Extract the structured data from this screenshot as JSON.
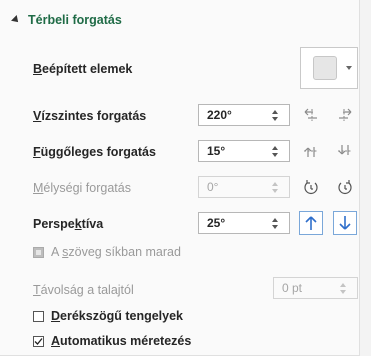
{
  "section": {
    "title": "Térbeli forgatás"
  },
  "presets": {
    "label_pre": "",
    "label_u": "B",
    "label_post": "eépített elemek"
  },
  "rows": {
    "x": {
      "label_pre": "",
      "label_u": "V",
      "label_post": "ízszintes forgatás",
      "value": "220°"
    },
    "y": {
      "label_pre": "",
      "label_u": "F",
      "label_post": "üggőleges forgatás",
      "value": "15°"
    },
    "z": {
      "label_pre": "",
      "label_u": "M",
      "label_post": "élységi forgatás",
      "value": "0°"
    },
    "p": {
      "label_pre": "Perspe",
      "label_u": "k",
      "label_post": "tíva",
      "value": "25°"
    }
  },
  "keep_text_flat": {
    "label_pre": "A ",
    "label_u": "s",
    "label_post": "zöveg síkban marad"
  },
  "distance": {
    "label_pre": "",
    "label_u": "T",
    "label_post": "ávolság a talajtól",
    "value": "0 pt"
  },
  "right_angle_axes": {
    "label_pre": "",
    "label_u": "D",
    "label_post": "erékszögű tengelyek",
    "checked": false
  },
  "autoscale": {
    "label_pre": "",
    "label_u": "A",
    "label_post": "utomatikus méretezés",
    "checked": true
  },
  "colors": {
    "accent": "#1f6b46",
    "icon_blue": "#2f6fcb",
    "icon_gray": "#8a8a8a"
  }
}
